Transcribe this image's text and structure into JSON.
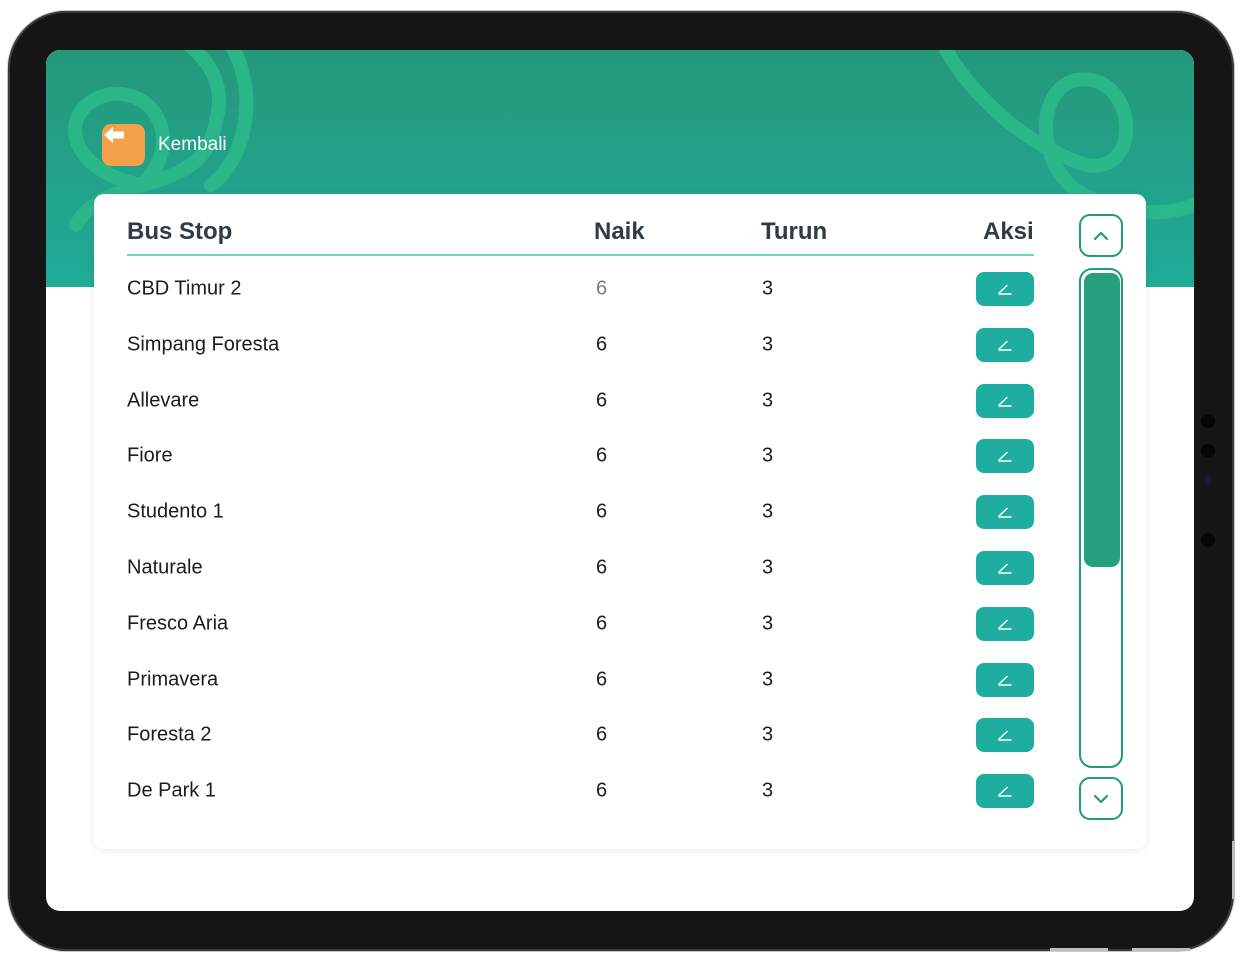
{
  "header": {
    "back_label": "Kembali",
    "back_icon": "arrow-left-icon",
    "colors": {
      "gradient_top": "#25987a",
      "gradient_bottom": "#1fab97",
      "back_button": "#f3a24a"
    }
  },
  "table": {
    "columns": {
      "bus_stop": "Bus Stop",
      "naik": "Naik",
      "turun": "Turun",
      "aksi": "Aksi"
    },
    "rows": [
      {
        "name": "CBD Timur 2",
        "naik": "6",
        "turun": "3"
      },
      {
        "name": "Simpang Foresta",
        "naik": "6",
        "turun": "3"
      },
      {
        "name": "Allevare",
        "naik": "6",
        "turun": "3"
      },
      {
        "name": "Fiore",
        "naik": "6",
        "turun": "3"
      },
      {
        "name": "Studento 1",
        "naik": "6",
        "turun": "3"
      },
      {
        "name": "Naturale",
        "naik": "6",
        "turun": "3"
      },
      {
        "name": "Fresco Aria",
        "naik": "6",
        "turun": "3"
      },
      {
        "name": "Primavera",
        "naik": "6",
        "turun": "3"
      },
      {
        "name": "Foresta 2",
        "naik": "6",
        "turun": "3"
      },
      {
        "name": "De Park 1",
        "naik": "6",
        "turun": "3"
      }
    ],
    "edit_icon": "edit-icon",
    "accent_color": "#1fada0"
  },
  "scrollbar": {
    "up_icon": "chevron-up-icon",
    "down_icon": "chevron-down-icon",
    "thumb_fraction": 0.6,
    "thumb_color": "#24a07e"
  }
}
